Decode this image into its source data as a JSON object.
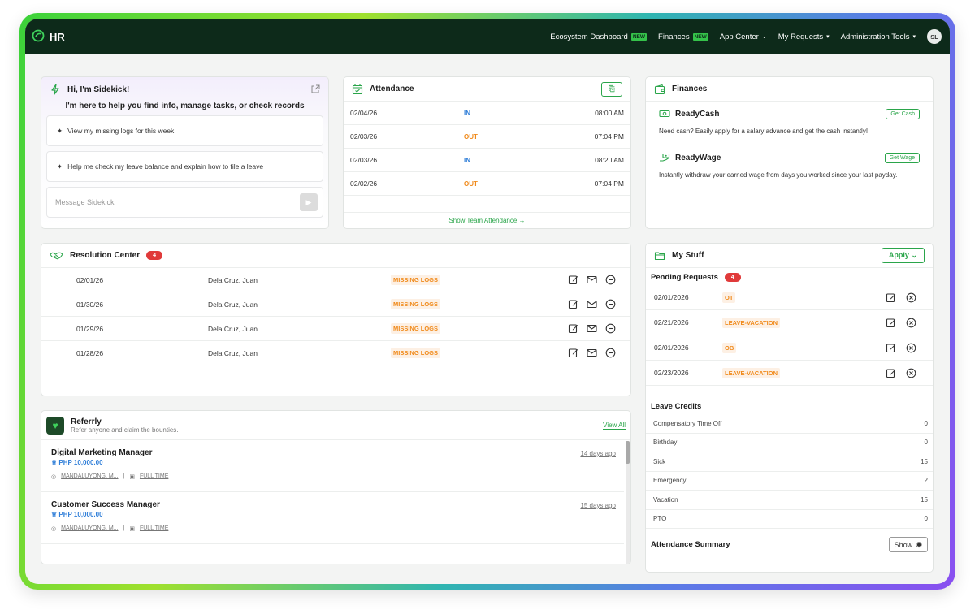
{
  "topbar": {
    "brand": "HR",
    "nav": [
      {
        "label": "Ecosystem Dashboard",
        "badge": "NEW"
      },
      {
        "label": "Finances",
        "badge": "NEW"
      },
      {
        "label": "App Center",
        "caret": "⌄"
      },
      {
        "label": "My Requests",
        "caret": "▾"
      },
      {
        "label": "Administration Tools",
        "caret": "▾"
      }
    ],
    "avatar": "SL"
  },
  "sidekick": {
    "title": "Hi, I'm Sidekick!",
    "subtitle": "I'm here to help you find info, manage tasks, or check records",
    "options": [
      "View my missing logs for this week",
      "Help me check my leave balance and explain how to file a leave"
    ],
    "input_placeholder": "Message Sidekick"
  },
  "attendance": {
    "title": "Attendance",
    "rows": [
      {
        "date": "02/04/26",
        "status": "IN",
        "time": "08:00 AM"
      },
      {
        "date": "02/03/26",
        "status": "OUT",
        "time": "07:04 PM"
      },
      {
        "date": "02/03/26",
        "status": "IN",
        "time": "08:20 AM"
      },
      {
        "date": "02/02/26",
        "status": "OUT",
        "time": "07:04 PM"
      }
    ],
    "footer_link": "Show Team Attendance →"
  },
  "finances": {
    "title": "Finances",
    "sections": [
      {
        "name": "ReadyCash",
        "button": "Get Cash",
        "desc": "Need cash? Easily apply for a salary advance and get the cash instantly!"
      },
      {
        "name": "ReadyWage",
        "button": "Get Wage",
        "desc": "Instantly withdraw your earned wage from days you worked since your last payday."
      }
    ]
  },
  "resolution": {
    "title": "Resolution Center",
    "count": "4",
    "rows": [
      {
        "date": "02/01/26",
        "name": "Dela Cruz, Juan",
        "tag": "MISSING LOGS"
      },
      {
        "date": "01/30/26",
        "name": "Dela Cruz, Juan",
        "tag": "MISSING LOGS"
      },
      {
        "date": "01/29/26",
        "name": "Dela Cruz, Juan",
        "tag": "MISSING LOGS"
      },
      {
        "date": "01/28/26",
        "name": "Dela Cruz, Juan",
        "tag": "MISSING LOGS"
      }
    ]
  },
  "referrly": {
    "title": "Referrly",
    "subtitle": "Refer anyone and claim the bounties.",
    "view_all": "View All",
    "jobs": [
      {
        "title": "Digital Marketing Manager",
        "pay": "PHP 10,000.00",
        "location": "MANDALUYONG, M...",
        "type": "FULL TIME",
        "ago": "14 days ago"
      },
      {
        "title": "Customer Success Manager",
        "pay": "PHP 10,000.00",
        "location": "MANDALUYONG, M...",
        "type": "FULL TIME",
        "ago": "15 days ago"
      }
    ]
  },
  "mystuff": {
    "title": "My Stuff",
    "apply": "Apply",
    "pending_title": "Pending Requests",
    "pending_count": "4",
    "pending": [
      {
        "date": "02/01/2026",
        "tag": "OT"
      },
      {
        "date": "02/21/2026",
        "tag": "LEAVE-VACATION"
      },
      {
        "date": "02/01/2026",
        "tag": "OB"
      },
      {
        "date": "02/23/2026",
        "tag": "LEAVE-VACATION"
      }
    ],
    "leave_title": "Leave Credits",
    "leave": [
      {
        "label": "Compensatory Time Off",
        "value": "0"
      },
      {
        "label": "Birthday",
        "value": "0"
      },
      {
        "label": "Sick",
        "value": "15"
      },
      {
        "label": "Emergency",
        "value": "2"
      },
      {
        "label": "Vacation",
        "value": "15"
      },
      {
        "label": "PTO",
        "value": "0"
      }
    ],
    "summary_title": "Attendance Summary",
    "show": "Show"
  },
  "colors": {
    "accent": "#2aa54a",
    "topbar": "#0d2a1a",
    "in": "#2f7ed8",
    "out": "#f08a1b",
    "badge": "#e03a3a"
  }
}
